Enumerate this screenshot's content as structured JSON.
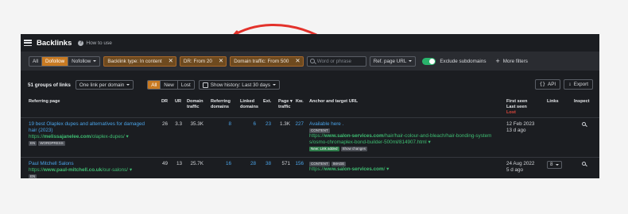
{
  "header": {
    "title": "Backlinks",
    "howto": "How to use"
  },
  "filters": {
    "link_types": [
      "All",
      "Dofollow",
      "Nofollow"
    ],
    "chips": [
      "Backlink type: In content",
      "DR: From 20",
      "Domain traffic: From 500"
    ],
    "search_placeholder": "Word or phrase",
    "ref_page": "Ref. page URL",
    "exclude_subdomains": "Exclude subdomains",
    "more_filters": "More filters"
  },
  "toolbar": {
    "groups": "51 groups of links",
    "grouping": "One link per domain",
    "scope": [
      "All",
      "New",
      "Lost"
    ],
    "history": "Show history: Last 30 days",
    "api": "API",
    "export": "Export"
  },
  "columns": {
    "ref_page": "Referring page",
    "dr": "DR",
    "ur": "UR",
    "domain_traffic_1": "Domain",
    "domain_traffic_2": "traffic",
    "ref_domains_1": "Referring",
    "ref_domains_2": "domains",
    "linked_domains_1": "Linked",
    "linked_domains_2": "domains",
    "ext": "Ext.",
    "page_traffic_1": "Page",
    "page_traffic_2": "traffic",
    "kw": "Kw.",
    "anchor": "Anchor and target URL",
    "first_seen": "First seen",
    "last_seen": "Last seen",
    "lost": "Lost",
    "links": "Links",
    "inspect": "Inspect"
  },
  "rows": [
    {
      "title_1": "19 best Olaplex dupes and alternatives for damaged",
      "title_2": "hair (2023)",
      "url_prefix": "https://",
      "url_domain": "melissajanelee.com",
      "url_path": "/olaplex-dupes/",
      "tags": [
        "EN",
        "WORDPRESS"
      ],
      "dr": "26",
      "ur": "3.3",
      "domain_traffic": "35.3K",
      "ref_domains": "8",
      "linked_domains": "6",
      "ext": "23",
      "page_traffic": "1.3K",
      "kw": "227",
      "anchor": "Available here .",
      "anchor_tags": [
        "CONTENT"
      ],
      "target_prefix": "https://",
      "target_domain": "www.salon-services.com",
      "target_path_1": "/hair/hair-colour-and-bleach/hair-bonding-system",
      "target_path_2": "s/osmo-chromaplex-bond-builder-500ml/814907.html",
      "status_tags": [
        "New: Link added",
        "Show changes"
      ],
      "first_seen": "12 Feb 2023",
      "last_seen": "13 d ago",
      "links": ""
    },
    {
      "title_1": "Paul Mitchell Salons",
      "title_2": "",
      "url_prefix": "https://",
      "url_domain": "www.paul-mitchell.co.uk",
      "url_path": "/our-salons/",
      "tags": [
        "EN"
      ],
      "dr": "49",
      "ur": "13",
      "domain_traffic": "25.7K",
      "ref_domains": "16",
      "linked_domains": "28",
      "ext": "38",
      "page_traffic": "571",
      "kw": "156",
      "anchor": "",
      "anchor_tags": [
        "CONTENT",
        "IMAGE"
      ],
      "target_prefix": "https://",
      "target_domain": "www.salon-services.com",
      "target_path_1": "/",
      "target_path_2": "",
      "status_tags": [],
      "first_seen": "24 Aug 2022",
      "last_seen": "5 d ago",
      "links": "8"
    }
  ],
  "colors": {
    "accent": "#c87a22",
    "link": "#4aa3e8",
    "url": "#3fbf73",
    "annotation": "#e3322b"
  }
}
